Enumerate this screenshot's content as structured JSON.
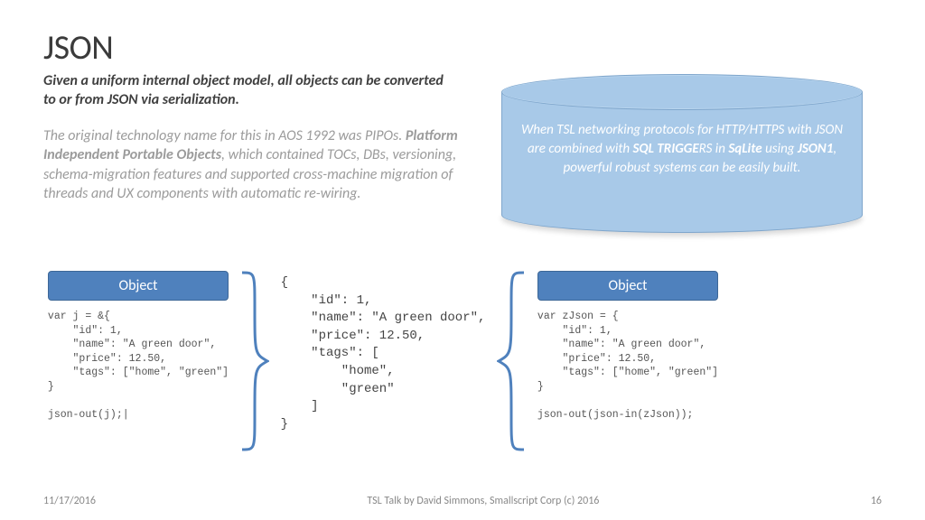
{
  "title": "JSON",
  "subtitle": "Given a uniform internal object model, all objects can be converted to or from JSON via serialization.",
  "desc": {
    "pre": "The original technology name for this in AOS 1992 was PIPOs. ",
    "bold": "Platform Independent Portable Objects",
    "post": ", which contained TOCs, DBs, versioning, schema-migration features and supported cross-machine migration of threads and UX components with automatic re-wiring."
  },
  "cylinder": {
    "l1": "When TSL networking protocols for HTTP/HTTPS with JSON are combined with ",
    "b1": "SQL TRIGGE",
    "l2": "RS in ",
    "b2": "SqLite",
    "l3": " using ",
    "b3": "JSON1",
    "l4": ", powerful robust systems can be easily built."
  },
  "labels": {
    "object_left": "Object",
    "object_right": "Object"
  },
  "code_left": "var j = &{\n    \"id\": 1,\n    \"name\": \"A green door\",\n    \"price\": 12.50,\n    \"tags\": [\"home\", \"green\"]\n}\n\njson-out(j);|",
  "code_mid": "{\n    \"id\": 1,\n    \"name\": \"A green door\",\n    \"price\": 12.50,\n    \"tags\": [\n        \"home\",\n        \"green\"\n    ]\n}",
  "code_right": "var zJson = {\n    \"id\": 1,\n    \"name\": \"A green door\",\n    \"price\": 12.50,\n    \"tags\": [\"home\", \"green\"]\n}\n\njson-out(json-in(zJson));",
  "footer": {
    "date": "11/17/2016",
    "center": "TSL Talk by David Simmons, Smallscript Corp (c) 2016",
    "page": "16"
  }
}
